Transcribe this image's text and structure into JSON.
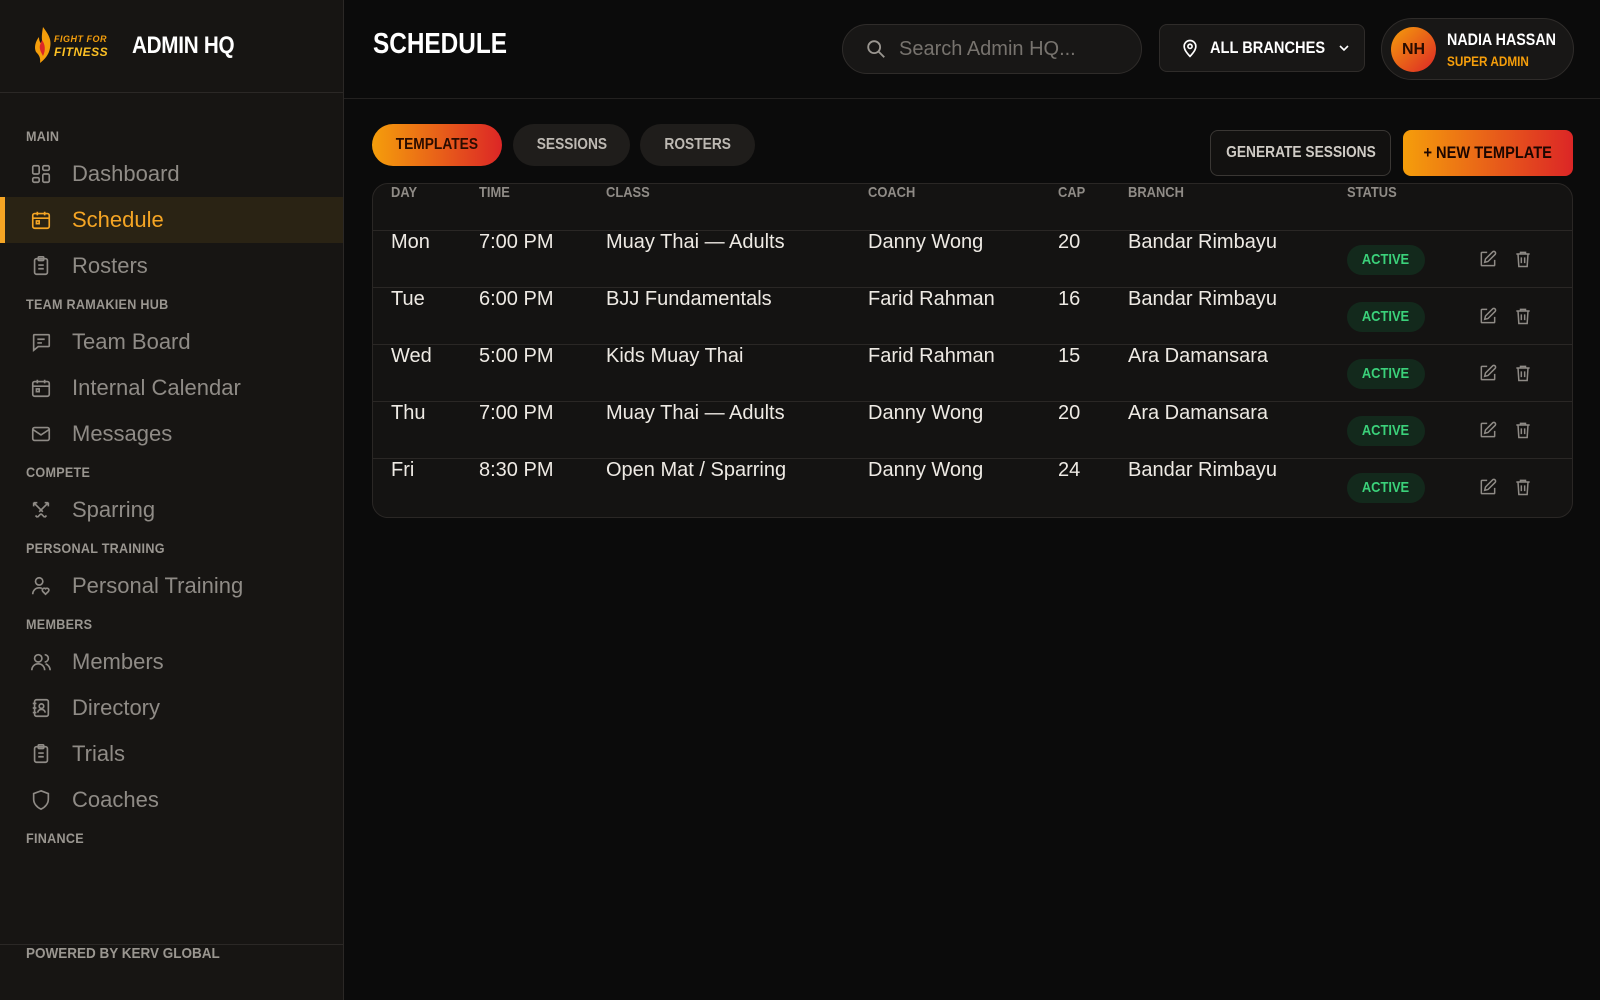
{
  "brand": {
    "logo_line1": "FIGHT FOR",
    "logo_line2": "FITNESS",
    "title": "ADMIN HQ"
  },
  "sidebar": {
    "sections": [
      {
        "label": "MAIN",
        "items": [
          {
            "label": "Dashboard",
            "icon": "dashboard-icon"
          },
          {
            "label": "Schedule",
            "icon": "calendar-icon",
            "active": true
          },
          {
            "label": "Rosters",
            "icon": "clipboard-icon"
          }
        ]
      },
      {
        "label": "TEAM RAMAKIEN HUB",
        "items": [
          {
            "label": "Team Board",
            "icon": "message-square-icon"
          },
          {
            "label": "Internal Calendar",
            "icon": "calendar-icon"
          },
          {
            "label": "Messages",
            "icon": "mail-icon"
          }
        ]
      },
      {
        "label": "COMPETE",
        "items": [
          {
            "label": "Sparring",
            "icon": "swords-icon"
          }
        ]
      },
      {
        "label": "PERSONAL TRAINING",
        "items": [
          {
            "label": "Personal Training",
            "icon": "user-heart-icon"
          }
        ]
      },
      {
        "label": "MEMBERS",
        "items": [
          {
            "label": "Members",
            "icon": "users-icon"
          },
          {
            "label": "Directory",
            "icon": "contact-book-icon"
          },
          {
            "label": "Trials",
            "icon": "clipboard-icon"
          },
          {
            "label": "Coaches",
            "icon": "shield-icon"
          }
        ]
      },
      {
        "label": "FINANCE",
        "items": []
      }
    ],
    "footer": "POWERED BY KERV GLOBAL"
  },
  "header": {
    "title": "SCHEDULE",
    "search_placeholder": "Search Admin HQ...",
    "branch_select": "ALL BRANCHES",
    "user": {
      "initials": "NH",
      "name": "NADIA HASSAN",
      "role": "SUPER ADMIN"
    }
  },
  "tabs": [
    {
      "label": "TEMPLATES",
      "active": true
    },
    {
      "label": "SESSIONS",
      "active": false
    },
    {
      "label": "ROSTERS",
      "active": false
    }
  ],
  "actions": {
    "generate": "GENERATE SESSIONS",
    "new": "+ NEW TEMPLATE"
  },
  "table": {
    "columns": [
      "DAY",
      "TIME",
      "CLASS",
      "COACH",
      "CAP",
      "BRANCH",
      "STATUS"
    ],
    "rows": [
      {
        "day": "Mon",
        "time": "7:00 PM",
        "class": "Muay Thai — Adults",
        "coach": "Danny Wong",
        "cap": "20",
        "branch": "Bandar Rimbayu",
        "status": "ACTIVE"
      },
      {
        "day": "Tue",
        "time": "6:00 PM",
        "class": "BJJ Fundamentals",
        "coach": "Farid Rahman",
        "cap": "16",
        "branch": "Bandar Rimbayu",
        "status": "ACTIVE"
      },
      {
        "day": "Wed",
        "time": "5:00 PM",
        "class": "Kids Muay Thai",
        "coach": "Farid Rahman",
        "cap": "15",
        "branch": "Ara Damansara",
        "status": "ACTIVE"
      },
      {
        "day": "Thu",
        "time": "7:00 PM",
        "class": "Muay Thai — Adults",
        "coach": "Danny Wong",
        "cap": "20",
        "branch": "Ara Damansara",
        "status": "ACTIVE"
      },
      {
        "day": "Fri",
        "time": "8:30 PM",
        "class": "Open Mat / Sparring",
        "coach": "Danny Wong",
        "cap": "24",
        "branch": "Bandar Rimbayu",
        "status": "ACTIVE"
      }
    ]
  },
  "colors": {
    "accent": "#f5a524",
    "accent_red": "#dc2626",
    "status_green": "#3bd17a",
    "background": "#0b0b0b",
    "sidebar": "#171513"
  }
}
